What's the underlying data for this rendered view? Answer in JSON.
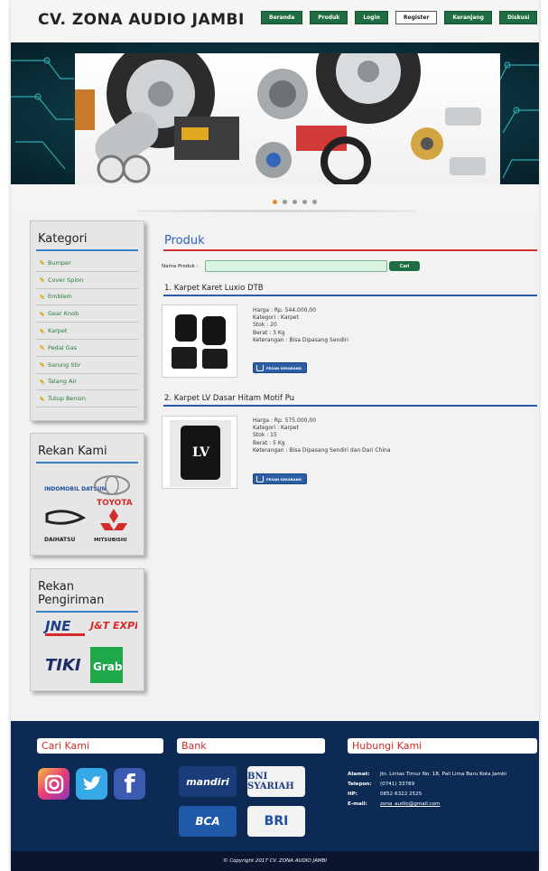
{
  "header": {
    "title": "CV. ZONA AUDIO JAMBI",
    "nav": [
      {
        "label": "Beranda",
        "active": false
      },
      {
        "label": "Produk",
        "active": false
      },
      {
        "label": "Login",
        "active": false
      },
      {
        "label": "Register",
        "active": true
      },
      {
        "label": "Keranjang",
        "active": false
      },
      {
        "label": "Diskusi",
        "active": false
      }
    ]
  },
  "slider": {
    "dot_count": 5,
    "active_dot": 1
  },
  "sidebar": {
    "category_title": "Kategori",
    "categories": [
      "Bumper",
      "Cover Spion",
      "Emblem",
      "Gear Knob",
      "Karpet",
      "Pedal Gas",
      "Sarung Stir",
      "Talang Air",
      "Tutup Bensin"
    ],
    "partners_title": "Rekan Kami",
    "partners": [
      "INDOMOBIL DATSUN",
      "TOYOTA",
      "DAIHATSU",
      "MITSUBISHI"
    ],
    "shipping_title": "Rekan Pengiriman",
    "shipping": [
      "JNE",
      "J&T EXPRESS",
      "TIKI",
      "Grab"
    ]
  },
  "main": {
    "title": "Produk",
    "search": {
      "label": "Nama Produk :",
      "value": "",
      "button": "Cari"
    },
    "order_label": "PESAN SEKARANG",
    "products": [
      {
        "name": "1. Karpet Karet Luxio DTB",
        "harga": "Harga : Rp. 544.000,00",
        "kategori": "Kategori : Karpet",
        "stok": "Stok : 20",
        "berat": "Berat : 3 Kg",
        "keterangan": "Keterangan : Bisa Dipasang Sendiri"
      },
      {
        "name": "2. Karpet LV Dasar Hitam Motif Pu",
        "harga": "Harga : Rp. 575.000,00",
        "kategori": "Kategori : Karpet",
        "stok": "Stok : 15",
        "berat": "Berat : 5 Kg",
        "keterangan": "Keterangan : Bisa Dipasang Sendiri dan Dari China"
      }
    ]
  },
  "footer": {
    "find_us_title": "Cari Kami",
    "bank_title": "Bank",
    "contact_title": "Hubungi Kami",
    "banks": [
      "mandiri",
      "BNI SYARIAH",
      "BCA",
      "BRI"
    ],
    "contact": {
      "alamat_label": "Alamat:",
      "alamat": "Jln. Lintas Timur No. 18, Pall Lima Baru Kota Jambi",
      "telepon_label": "Telepon:",
      "telepon": "(0741) 33789",
      "hp_label": "HP:",
      "hp": "0852 6322 2525",
      "email_label": "E-mail:",
      "email": "zona_audio@gmail.com"
    },
    "copyright": "© Copyright 2017 CV. ZONA AUDIO JAMBI"
  },
  "colors": {
    "nav_green": "#1f6e43",
    "title_blue": "#2c62b8",
    "rule_red": "#d43030",
    "footer_navy": "#0d2a55"
  }
}
